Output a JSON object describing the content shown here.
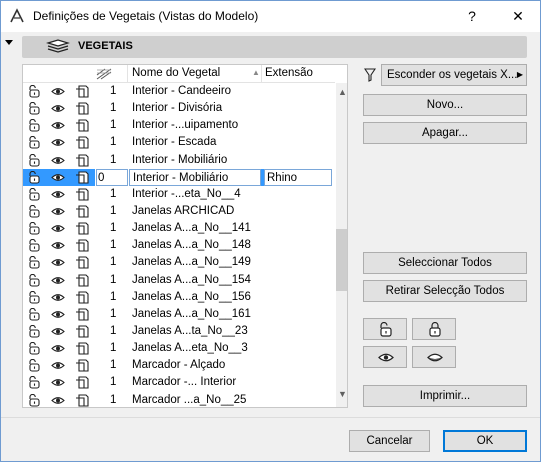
{
  "window": {
    "title": "Definições de Vegetais (Vistas do Modelo)",
    "help_label": "?",
    "close_label": "✕"
  },
  "header": {
    "title": "VEGETAIS"
  },
  "table": {
    "columns": {
      "name": "Nome do Vegetal",
      "extension": "Extensão"
    },
    "rows": [
      {
        "pen": "1",
        "name": "Interior - Candeeiro",
        "extension": ""
      },
      {
        "pen": "1",
        "name": "Interior - Divisória",
        "extension": ""
      },
      {
        "pen": "1",
        "name": "Interior -...uipamento",
        "extension": ""
      },
      {
        "pen": "1",
        "name": "Interior - Escada",
        "extension": ""
      },
      {
        "pen": "1",
        "name": "Interior - Mobiliário",
        "extension": ""
      },
      {
        "pen": "0",
        "name": "Interior - Mobiliário",
        "extension": "Rhino",
        "selected": true
      },
      {
        "pen": "1",
        "name": "Interior -...eta_No__4",
        "extension": ""
      },
      {
        "pen": "1",
        "name": "Janelas ARCHICAD",
        "extension": ""
      },
      {
        "pen": "1",
        "name": "Janelas A...a_No__141",
        "extension": ""
      },
      {
        "pen": "1",
        "name": "Janelas A...a_No__148",
        "extension": ""
      },
      {
        "pen": "1",
        "name": "Janelas A...a_No__149",
        "extension": ""
      },
      {
        "pen": "1",
        "name": "Janelas A...a_No__154",
        "extension": ""
      },
      {
        "pen": "1",
        "name": "Janelas A...a_No__156",
        "extension": ""
      },
      {
        "pen": "1",
        "name": "Janelas A...a_No__161",
        "extension": ""
      },
      {
        "pen": "1",
        "name": "Janelas A...ta_No__23",
        "extension": ""
      },
      {
        "pen": "1",
        "name": "Janelas A...eta_No__3",
        "extension": ""
      },
      {
        "pen": "1",
        "name": "Marcador - Alçado",
        "extension": ""
      },
      {
        "pen": "1",
        "name": "Marcador -... Interior",
        "extension": ""
      },
      {
        "pen": "1",
        "name": "Marcador ...a_No__25",
        "extension": ""
      }
    ]
  },
  "side": {
    "filter_dropdown": "Esconder os vegetais X...",
    "new_button": "Novo...",
    "delete_button": "Apagar...",
    "select_all_button": "Seleccionar Todos",
    "deselect_all_button": "Retirar Selecção Todos",
    "print_button": "Imprimir..."
  },
  "footer": {
    "cancel_button": "Cancelar",
    "ok_button": "OK"
  },
  "colors": {
    "selection": "#3399ff",
    "accent": "#0078d7"
  }
}
